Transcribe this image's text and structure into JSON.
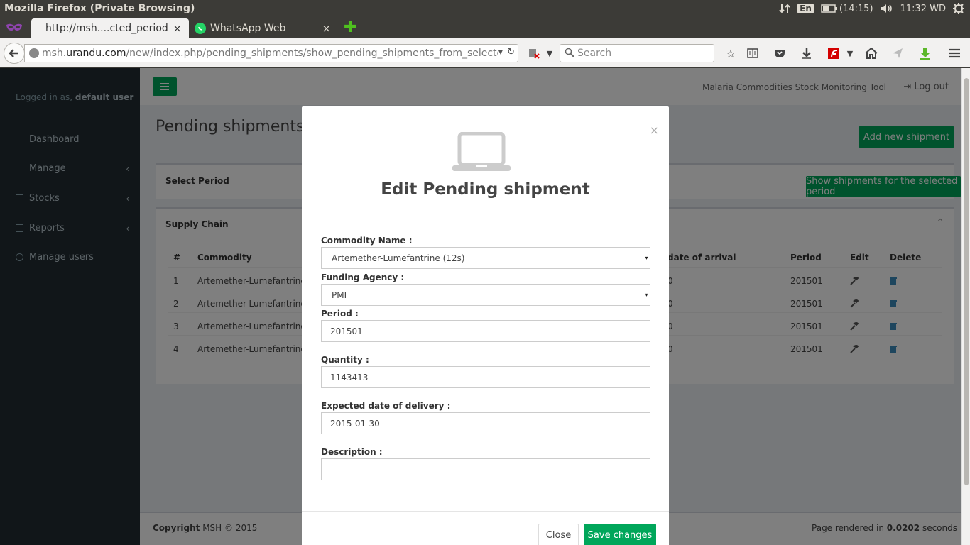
{
  "os": {
    "window_title": "Mozilla Firefox (Private Browsing)",
    "lang": "En",
    "battery": "(14:15)",
    "clock": "11:32 WD"
  },
  "tabs": [
    {
      "label": "http://msh....cted_period",
      "close": "×"
    },
    {
      "label": "WhatsApp Web",
      "close": "×"
    }
  ],
  "newtab": "✚",
  "nav": {
    "url_prefix": "msh.",
    "url_domain": "urandu.com",
    "url_path": "/new/index.php/pending_shipments/show_pending_shipments_from_selecte",
    "search_placeholder": "Search"
  },
  "sidebar": {
    "logged_prefix": "Logged in as,",
    "user": "default user",
    "items": [
      {
        "label": "Dashboard",
        "chevron": ""
      },
      {
        "label": "Manage",
        "chevron": "‹"
      },
      {
        "label": "Stocks",
        "chevron": "‹"
      },
      {
        "label": "Reports",
        "chevron": "‹"
      },
      {
        "label": "Manage users",
        "chevron": ""
      }
    ]
  },
  "header": {
    "app_name": "Malaria Commodities Stock Monitoring Tool",
    "logout": "Log out"
  },
  "content": {
    "title": "Pending shipments",
    "add_button": "Add new shipment",
    "select_period": "Select Period",
    "show_button": "Show shipments for the selected period",
    "supply_chain": "Supply Chain",
    "columns": [
      "#",
      "Commodity",
      "date of arrival",
      "Period",
      "Edit",
      "Delete"
    ],
    "rows": [
      {
        "num": "1",
        "commodity": "Artemether-Lumefantrine (",
        "arrival": "0",
        "period": "201501"
      },
      {
        "num": "2",
        "commodity": "Artemether-Lumefantrine (",
        "arrival": "0",
        "period": "201501"
      },
      {
        "num": "3",
        "commodity": "Artemether-Lumefantrine (",
        "arrival": "0",
        "period": "201501"
      },
      {
        "num": "4",
        "commodity": "Artemether-Lumefantrine (",
        "arrival": "0",
        "period": "201501"
      }
    ]
  },
  "footer": {
    "copyright_bold": "Copyright",
    "copyright_rest": "MSH © 2015",
    "rendered_prefix": "Page rendered in",
    "rendered_time": "0.0202",
    "rendered_suffix": "seconds"
  },
  "modal": {
    "close_x": "×",
    "title": "Edit Pending shipment",
    "commodity_label": "Commodity Name :",
    "commodity_value": "Artemether-Lumefantrine (12s)",
    "agency_label": "Funding Agency :",
    "agency_value": "PMI",
    "period_label": "Period :",
    "period_value": "201501",
    "quantity_label": "Quantity :",
    "quantity_value": "1143413",
    "date_label": "Expected date of delivery :",
    "date_value": "2015-01-30",
    "description_label": "Description :",
    "description_value": "",
    "close_button": "Close",
    "save_button": "Save changes"
  },
  "colors": {
    "accent_green": "#00a65a",
    "sidebar_bg": "#222d32"
  }
}
